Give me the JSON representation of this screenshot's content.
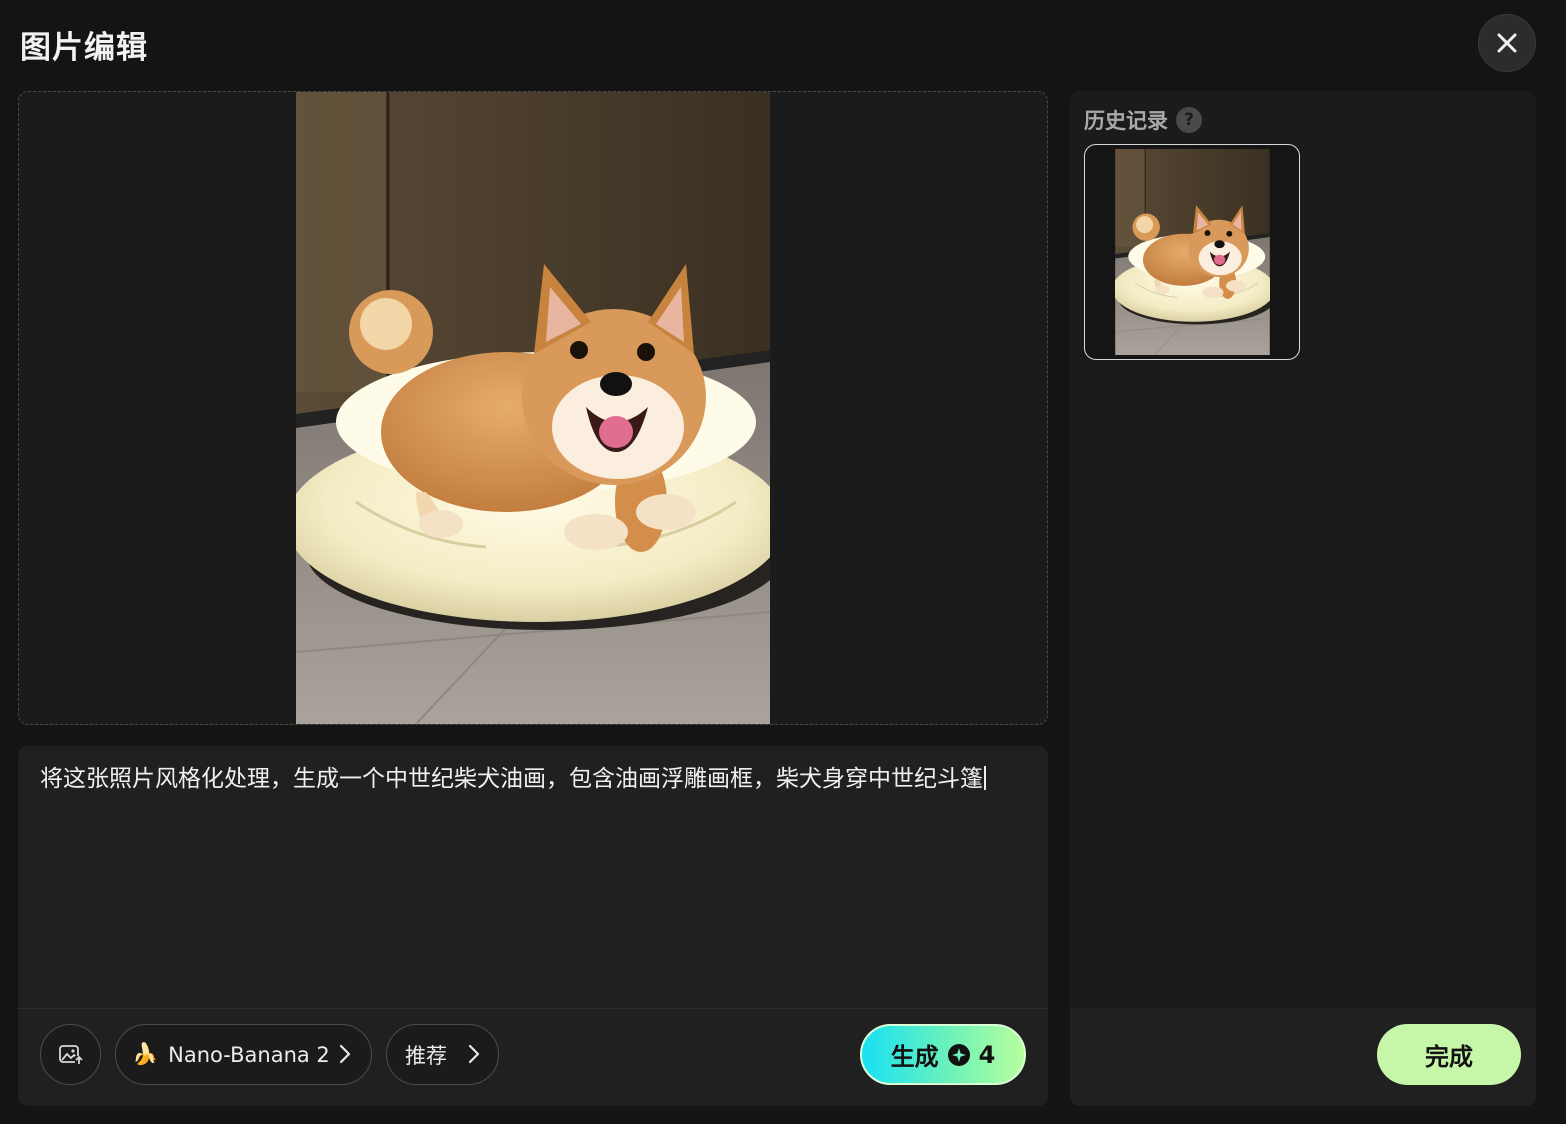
{
  "header": {
    "title": "图片编辑",
    "close_icon": "close-icon"
  },
  "preview": {
    "image_subject": "shiba-inu-on-cushion-photo"
  },
  "prompt": {
    "text": "将这张照片风格化处理，生成一个中世纪柴犬油画，包含油画浮雕画框，柴犬身穿中世纪斗篷"
  },
  "toolbar": {
    "upload_icon": "image-upload-icon",
    "model_emoji": "🍌",
    "model_label": "Nano-Banana 2",
    "recommend_label": "推荐",
    "generate_label": "生成",
    "generate_cost": "4",
    "credit_icon": "credit-icon"
  },
  "history": {
    "title": "历史记录",
    "help_glyph": "?",
    "done_label": "完成"
  },
  "colors": {
    "background": "#141414",
    "panel": "#202020",
    "generate_gradient_start": "#18e0f3",
    "generate_gradient_end": "#b7ff9e",
    "done_button": "#c6f7a8"
  }
}
